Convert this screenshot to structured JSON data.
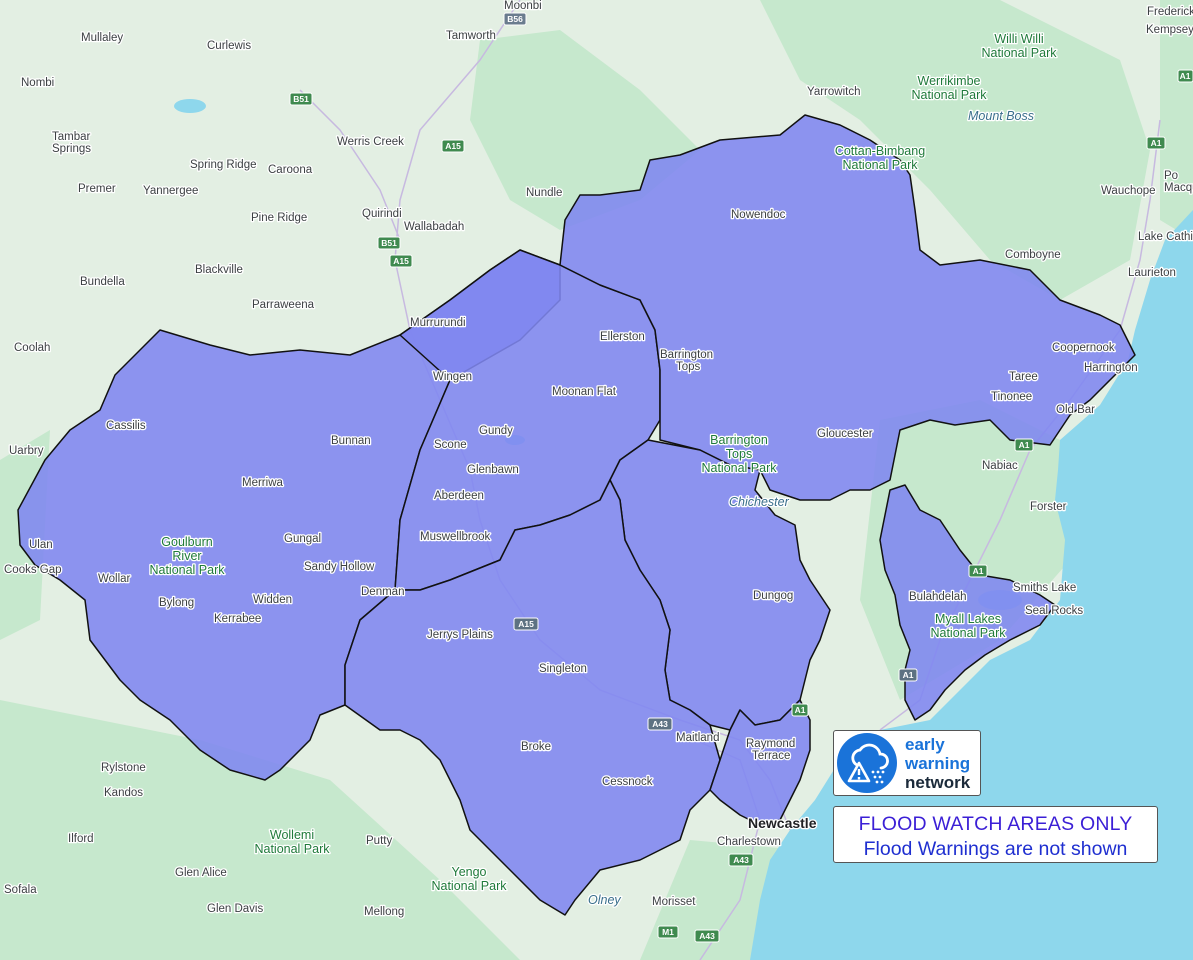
{
  "map": {
    "colors": {
      "land": "#e3efe3",
      "forest": "#c6e8cd",
      "sea": "#8ed7ec",
      "watch_area": "#7f86f0",
      "boundary": "#111111"
    },
    "places": [
      {
        "name": "Moonbi"
      },
      {
        "name": "Tamworth"
      },
      {
        "name": "Mullaley"
      },
      {
        "name": "Curlewis"
      },
      {
        "name": "Nombi"
      },
      {
        "name": "Tambar"
      },
      {
        "name": "Springs"
      },
      {
        "name": "Werris Creek"
      },
      {
        "name": "Spring Ridge"
      },
      {
        "name": "Caroona"
      },
      {
        "name": "Premer"
      },
      {
        "name": "Yannergee"
      },
      {
        "name": "Pine Ridge"
      },
      {
        "name": "Quirindi"
      },
      {
        "name": "Wallabadah"
      },
      {
        "name": "Nundle"
      },
      {
        "name": "Yarrowitch"
      },
      {
        "name": "Bundella"
      },
      {
        "name": "Blackville"
      },
      {
        "name": "Parraweena"
      },
      {
        "name": "Nowendoc"
      },
      {
        "name": "Comboyne"
      },
      {
        "name": "Wauchope"
      },
      {
        "name": "Lake Cathi"
      },
      {
        "name": "Laurieton"
      },
      {
        "name": "Kempsey"
      },
      {
        "name": "Frederick"
      },
      {
        "name": "Macqu"
      },
      {
        "name": "Po"
      },
      {
        "name": "Murrurundi"
      },
      {
        "name": "Ellerston"
      },
      {
        "name": "Barrington"
      },
      {
        "name": "Tops"
      },
      {
        "name": "Coopernook"
      },
      {
        "name": "Harrington"
      },
      {
        "name": "Taree"
      },
      {
        "name": "Tinonee"
      },
      {
        "name": "Old Bar"
      },
      {
        "name": "Coolah"
      },
      {
        "name": "Wingen"
      },
      {
        "name": "Moonan Flat"
      },
      {
        "name": "Cassilis"
      },
      {
        "name": "Bunnan"
      },
      {
        "name": "Gundy"
      },
      {
        "name": "Scone"
      },
      {
        "name": "Uarbry"
      },
      {
        "name": "Glenbawn"
      },
      {
        "name": "Gloucester"
      },
      {
        "name": "Nabiac"
      },
      {
        "name": "Merriwa"
      },
      {
        "name": "Aberdeen"
      },
      {
        "name": "Forster"
      },
      {
        "name": "Ulan"
      },
      {
        "name": "Gungal"
      },
      {
        "name": "Muswellbrook"
      },
      {
        "name": "Cooks Gap"
      },
      {
        "name": "Wollar"
      },
      {
        "name": "Sandy Hollow"
      },
      {
        "name": "Denman"
      },
      {
        "name": "Bylong"
      },
      {
        "name": "Widden"
      },
      {
        "name": "Kerrabee"
      },
      {
        "name": "Dungog"
      },
      {
        "name": "Bulahdelah"
      },
      {
        "name": "Smiths Lake"
      },
      {
        "name": "Seal Rocks"
      },
      {
        "name": "Jerrys Plains"
      },
      {
        "name": "Singleton"
      },
      {
        "name": "Maitland"
      },
      {
        "name": "Raymond"
      },
      {
        "name": "Terrace"
      },
      {
        "name": "Broke"
      },
      {
        "name": "Rylstone"
      },
      {
        "name": "Kandos"
      },
      {
        "name": "Cessnock"
      },
      {
        "name": "Newcastle"
      },
      {
        "name": "Charlestown"
      },
      {
        "name": "Ilford"
      },
      {
        "name": "Putty"
      },
      {
        "name": "Glen Alice"
      },
      {
        "name": "Sofala"
      },
      {
        "name": "Glen Davis"
      },
      {
        "name": "Mellong"
      },
      {
        "name": "Morisset"
      }
    ],
    "parks": [
      {
        "name": "Willi Willi"
      },
      {
        "name": "National Park"
      },
      {
        "name": "Werrikimbe"
      },
      {
        "name": "National Park"
      },
      {
        "name": "Cottan-Bimbang"
      },
      {
        "name": "National Park"
      },
      {
        "name": "Barrington"
      },
      {
        "name": "Tops"
      },
      {
        "name": "National Park"
      },
      {
        "name": "Goulburn"
      },
      {
        "name": "River"
      },
      {
        "name": "National Park"
      },
      {
        "name": "Myall Lakes"
      },
      {
        "name": "National Park"
      },
      {
        "name": "Wollemi"
      },
      {
        "name": "National Park"
      },
      {
        "name": "Yengo"
      },
      {
        "name": "National Park"
      }
    ],
    "features": [
      {
        "name": "Mount Boss"
      },
      {
        "name": "Chichester"
      },
      {
        "name": "Olney"
      }
    ],
    "roads": [
      {
        "name": "B56"
      },
      {
        "name": "B51"
      },
      {
        "name": "A15"
      },
      {
        "name": "B51"
      },
      {
        "name": "A15"
      },
      {
        "name": "A1"
      },
      {
        "name": "A1"
      },
      {
        "name": "A1"
      },
      {
        "name": "A1"
      },
      {
        "name": "A15"
      },
      {
        "name": "A1"
      },
      {
        "name": "A43"
      },
      {
        "name": "A43"
      },
      {
        "name": "M1"
      },
      {
        "name": "A43"
      }
    ]
  },
  "logo": {
    "line1": "early",
    "line2": "warning",
    "line3": "network"
  },
  "notice": {
    "line1": "FLOOD WATCH AREAS ONLY",
    "line2": "Flood Warnings are not shown"
  }
}
